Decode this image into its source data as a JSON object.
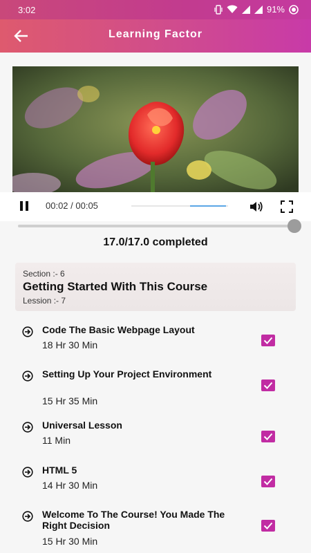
{
  "status_bar": {
    "time": "3:02",
    "battery": "91%"
  },
  "app_bar": {
    "title": "Learning Factor"
  },
  "player": {
    "time_display": "00:02 / 00:05"
  },
  "progress": {
    "completed_text": "17.0/17.0  completed",
    "fraction": 1.0
  },
  "section": {
    "section_label": "Section :-  6",
    "title": "Getting Started With This Course",
    "lesson_label": "Lession :-  7"
  },
  "lessons": [
    {
      "title": "Code The Basic Webpage Layout",
      "duration": "18 Hr 30 Min",
      "checked": true
    },
    {
      "title": "Setting Up Your Project Environment",
      "duration": "15 Hr 35 Min",
      "checked": true
    },
    {
      "title": "Universal Lesson",
      "duration": "11 Min",
      "checked": true
    },
    {
      "title": "HTML 5",
      "duration": "14 Hr 30 Min",
      "checked": true
    },
    {
      "title": "Welcome To The Course! You Made The Right Decision",
      "duration": "15 Hr 30 Min",
      "checked": true
    }
  ],
  "colors": {
    "accent": "#c12ca3",
    "appbar_start": "#de5a6e",
    "appbar_end": "#c83aa8"
  },
  "icons": [
    "back-arrow-icon",
    "pause-icon",
    "volume-icon",
    "fullscreen-icon",
    "arrow-circle-icon",
    "checkbox-checked-icon"
  ]
}
